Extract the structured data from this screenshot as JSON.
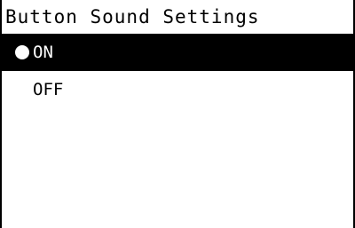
{
  "screen": {
    "title": "Button Sound Settings"
  },
  "options": [
    {
      "label": "ON",
      "selected": true
    },
    {
      "label": "OFF",
      "selected": false
    }
  ],
  "colors": {
    "background": "#ffffff",
    "highlight": "#000000",
    "text": "#000000",
    "highlight_text": "#ffffff"
  }
}
